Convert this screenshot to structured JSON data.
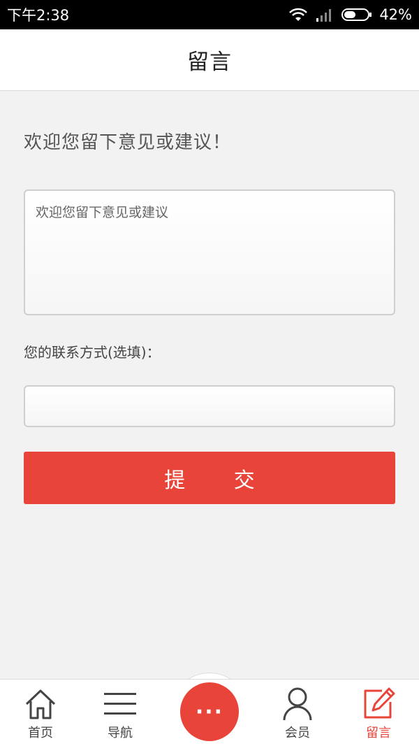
{
  "status_bar": {
    "time": "下午2:38",
    "battery": "42%"
  },
  "header": {
    "title": "留言"
  },
  "form": {
    "intro": "欢迎您留下意见或建议！",
    "message_placeholder": "欢迎您留下意见或建议",
    "contact_label": "您的联系方式(选填)：",
    "contact_value": "",
    "submit_label": "提 交"
  },
  "tabbar": {
    "items": [
      {
        "label": "首页",
        "icon": "home-icon",
        "active": false
      },
      {
        "label": "导航",
        "icon": "menu-icon",
        "active": false
      },
      {
        "label": "",
        "icon": "more-icon",
        "active": false
      },
      {
        "label": "会员",
        "icon": "user-icon",
        "active": false
      },
      {
        "label": "留言",
        "icon": "edit-icon",
        "active": true
      }
    ],
    "center_glyph": "···"
  },
  "colors": {
    "accent": "#e9443a",
    "background": "#f2f2f2"
  }
}
